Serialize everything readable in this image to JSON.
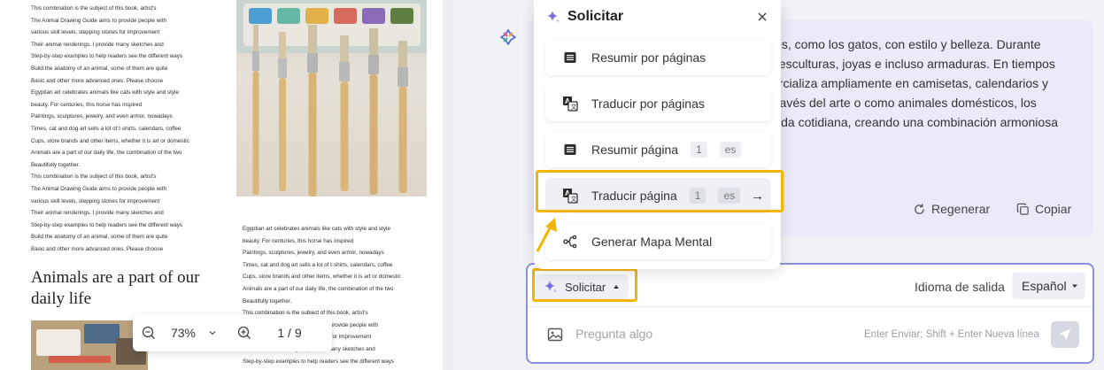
{
  "pdf": {
    "left_column_lines": [
      "This combination is the subject of this book, artist's",
      "The Animal Drawing Guide aims to provide people with",
      "various skill levels, stepping stones for improvement",
      "Their animal renderings. I provide many sketches and",
      "Step-by-step examples to help readers see the different ways",
      "Build the anatomy of an animal, some of them are quite",
      "Basic and other more advanced ones. Please choose",
      "Egyptian art celebrates animals like cats with style and style",
      "beauty. For centuries, this horse has inspired",
      "Paintings, sculptures, jewelry, and even armor, nowadays",
      "Times, cat and dog art sells a lot of t-shirts, calendars, coffee",
      "Cups, store brands and other items, whether it is art or domestic",
      "Animals are a part of our daily life, the combination of the two",
      "Beautifully together.",
      "This combination is the subject of this book, artist's",
      "The Animal Drawing Guide aims to provide people with",
      "various skill levels, stepping stones for improvement",
      "Their animal renderings. I provide many sketches and",
      "Step-by-step examples to help readers see the different ways",
      "Build the anatomy of an animal, some of them are quite",
      "Basic and other more advanced ones. Please choose"
    ],
    "heading": "Animals are a part of our daily life",
    "right_column_lines": [
      "Egyptian art celebrates animals like cats with style and style",
      "beauty. For centuries, this horse has inspired",
      "Paintings, sculptures, jewelry, and even armor, nowadays",
      "Times, cat and dog art sells a lot of t-shirts, calendars, coffee",
      "Cups, store brands and other items, whether it is art or domestic",
      "Animals are a part of our daily life, the combination of the two",
      "Beautifully together.",
      "This combination is the subject of this book, artist's",
      "The Animal Drawing Guide aims to provide people with",
      "various skill levels, stepping stones for improvement",
      "Their animal renderings. I provide many sketches and",
      "Step-by-step examples to help readers see the different ways"
    ]
  },
  "zoom_bar": {
    "zoom": "73%",
    "page_indicator": "1 / 9"
  },
  "chat": {
    "response_lines": [
      "les, como los gatos, con estilo y belleza. Durante",
      ", esculturas, joyas e incluso armaduras. En tiempos",
      "ercializa ampliamente en camisetas, calendarios y",
      "través del arte o como animales domésticos, los",
      "vida cotidiana, creando una combinación armoniosa"
    ],
    "regenerate": "Regenerar",
    "copy": "Copiar"
  },
  "popup": {
    "title": "Solicitar",
    "items": [
      {
        "label": "Resumir por páginas",
        "icon": "list-icon"
      },
      {
        "label": "Traducir por páginas",
        "icon": "translate-icon"
      },
      {
        "label": "Resumir página",
        "page": "1",
        "lang": "es",
        "icon": "list-icon"
      },
      {
        "label": "Traducir página",
        "page": "1",
        "lang": "es",
        "arrow": "→",
        "icon": "translate-icon"
      },
      {
        "label": "Generar Mapa Mental",
        "icon": "mindmap-icon"
      }
    ]
  },
  "composer": {
    "solicitar": "Solicitar",
    "output_language_label": "Idioma de salida",
    "output_language": "Español",
    "placeholder": "Pregunta algo",
    "hint": "Enter Enviar; Shift + Enter Nueva línea"
  },
  "colors": {
    "highlight": "#f4b400",
    "accent": "#8a8fe0",
    "bubble": "#ebeaf8"
  }
}
